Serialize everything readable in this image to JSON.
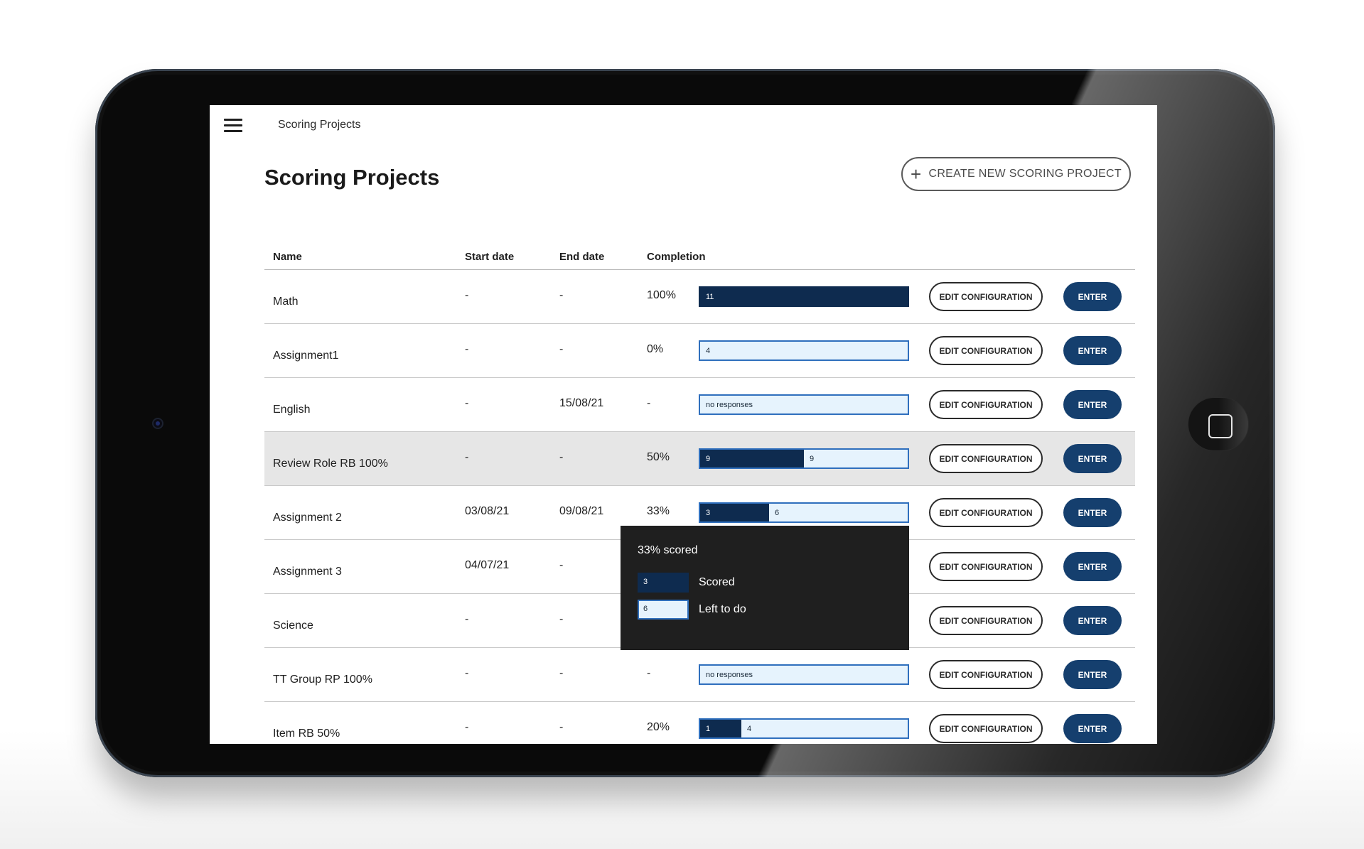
{
  "header": {
    "title": "Scoring Projects"
  },
  "page": {
    "title": "Scoring Projects",
    "create_button_label": "CREATE NEW SCORING PROJECT"
  },
  "columns": {
    "name": "Name",
    "start": "Start date",
    "end": "End date",
    "completion": "Completion"
  },
  "rows": [
    {
      "name": "Math",
      "start": "-",
      "end": "-",
      "completion": "100%",
      "fraction": 1.0,
      "scored": "11",
      "left": "",
      "bar_text": "",
      "highlight": false
    },
    {
      "name": "Assignment1",
      "start": "-",
      "end": "-",
      "completion": "0%",
      "fraction": 0.0,
      "scored": "",
      "left": "4",
      "bar_text": "",
      "highlight": false
    },
    {
      "name": "English",
      "start": "-",
      "end": "15/08/21",
      "completion": "-",
      "fraction": 0.0,
      "scored": "",
      "left": "",
      "bar_text": "no responses",
      "highlight": false
    },
    {
      "name": "Review Role RB 100%",
      "start": "-",
      "end": "-",
      "completion": "50%",
      "fraction": 0.5,
      "scored": "9",
      "left": "9",
      "bar_text": "",
      "highlight": true
    },
    {
      "name": "Assignment 2",
      "start": "03/08/21",
      "end": "09/08/21",
      "completion": "33%",
      "fraction": 0.3333,
      "scored": "3",
      "left": "6",
      "bar_text": "",
      "highlight": false
    },
    {
      "name": "Assignment 3",
      "start": "04/07/21",
      "end": "-",
      "completion": "",
      "fraction": 0.0,
      "scored": "",
      "left": "",
      "bar_text": "",
      "highlight": false
    },
    {
      "name": "Science",
      "start": "-",
      "end": "-",
      "completion": "",
      "fraction": 0.0,
      "scored": "",
      "left": "",
      "bar_text": "",
      "highlight": false
    },
    {
      "name": "TT Group RP 100%",
      "start": "-",
      "end": "-",
      "completion": "-",
      "fraction": 0.0,
      "scored": "",
      "left": "",
      "bar_text": "no responses",
      "highlight": false
    },
    {
      "name": "Item RB 50%",
      "start": "-",
      "end": "-",
      "completion": "20%",
      "fraction": 0.2,
      "scored": "1",
      "left": "4",
      "bar_text": "",
      "highlight": false
    }
  ],
  "actions": {
    "edit_label": "EDIT CONFIGURATION",
    "enter_label": "ENTER"
  },
  "tooltip": {
    "title": "33% scored",
    "scored_value": "3",
    "scored_label": "Scored",
    "left_value": "6",
    "left_label": "Left to do"
  },
  "colors": {
    "scored": "#0e2b4f",
    "left": "#e6f3fd",
    "bar_border": "#2f6fbd",
    "enter": "#153f6e"
  }
}
